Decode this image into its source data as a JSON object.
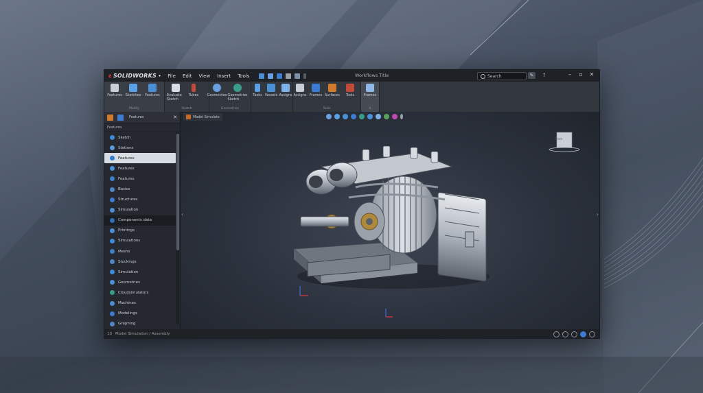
{
  "app": {
    "name": "SOLIDWORKS",
    "document_title": "Workflows Title"
  },
  "menu": [
    "File",
    "Edit",
    "View",
    "Insert",
    "Tools"
  ],
  "search": {
    "placeholder": "Search"
  },
  "ribbon": {
    "groups": [
      {
        "label": "Modify",
        "buttons": [
          "Features",
          "Sketches",
          "Features"
        ]
      },
      {
        "label": "Sketch",
        "buttons": [
          "Evaluate Sketch",
          "Tubes",
          "Geometries"
        ]
      },
      {
        "label": "Geometries",
        "buttons": [
          "Geometries Sketch"
        ]
      },
      {
        "label": "",
        "buttons": [
          "Tasks",
          "Vessels",
          "Assigns"
        ]
      },
      {
        "label": "Tools",
        "buttons": [
          "Assigns",
          "Frames",
          "Surfaces",
          "Tools"
        ]
      },
      {
        "label": "",
        "buttons": [
          "Frames"
        ]
      }
    ]
  },
  "sidebar": {
    "tab_label": "Features",
    "header": "Features",
    "items": [
      {
        "label": "Sketch",
        "color": "#3d8bd8"
      },
      {
        "label": "Stations",
        "color": "#5a9be0"
      },
      {
        "label": "Features",
        "color": "#2f7fd0",
        "state": "selected"
      },
      {
        "label": "Features",
        "color": "#4a90d9"
      },
      {
        "label": "Features",
        "color": "#3a7fc8"
      },
      {
        "label": "Basics",
        "color": "#4f86c6"
      },
      {
        "label": "Structures",
        "color": "#3d7bd0"
      },
      {
        "label": "Simulation",
        "color": "#4a8fd6"
      },
      {
        "label": "Components data",
        "color": "#2f6fb8",
        "state": "highlight"
      },
      {
        "label": "Printings",
        "color": "#4a8fd6"
      },
      {
        "label": "Simulations",
        "color": "#3d8bd8"
      },
      {
        "label": "Meshs",
        "color": "#3a7fc8"
      },
      {
        "label": "Stockings",
        "color": "#4f86c6"
      },
      {
        "label": "Simulation",
        "color": "#3d8bd8"
      },
      {
        "label": "Geometries",
        "color": "#4a90d9"
      },
      {
        "label": "Cloudsimulators",
        "color": "#3a9d8a"
      },
      {
        "label": "Machines",
        "color": "#4a8fd6"
      },
      {
        "label": "Modelings",
        "color": "#3d7bd0"
      },
      {
        "label": "Graphing",
        "color": "#4f86c6"
      }
    ]
  },
  "viewport": {
    "tab_label": "Model Simulate",
    "viewcube_label": "Front"
  },
  "statusbar": {
    "text": "Model Simulation / Assembly",
    "left_number": "10"
  }
}
